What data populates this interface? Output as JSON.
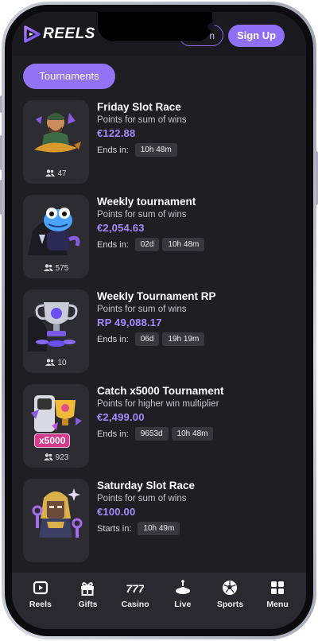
{
  "brand": {
    "name": "REELS"
  },
  "header": {
    "login_label": "n",
    "signup_label": "Sign Up"
  },
  "tab": {
    "label": "Tournaments"
  },
  "tournaments": [
    {
      "title": "Friday Slot Race",
      "desc": "Points for sum of wins",
      "prize": "€122.88",
      "timer_label": "Ends in:",
      "chips": [
        "10h 48m"
      ],
      "players": "47",
      "art": "fisher"
    },
    {
      "title": "Weekly tournament",
      "desc": "Points for sum of wins",
      "prize": "€2,054.63",
      "timer_label": "Ends in:",
      "chips": [
        "02d",
        "10h 48m"
      ],
      "players": "575",
      "art": "frog"
    },
    {
      "title": "Weekly Tournament RP",
      "desc": "Points for sum of wins",
      "prize": "RP  49,088.17",
      "timer_label": "Ends in:",
      "chips": [
        "06d",
        "19h 19m"
      ],
      "players": "10",
      "art": "trophy"
    },
    {
      "title": "Catch x5000 Tournament",
      "desc": "Points for higher win multiplier",
      "prize": "€2,499.00",
      "timer_label": "Ends in:",
      "chips": [
        "9653d",
        "10h 48m"
      ],
      "players": "923",
      "art": "x5000",
      "badge": "x5000"
    },
    {
      "title": "Saturday Slot Race",
      "desc": "Points for sum of wins",
      "prize": "€100.00",
      "timer_label": "Starts in:",
      "chips": [
        "10h 49m"
      ],
      "players": "",
      "art": "pharaoh"
    }
  ],
  "nav": [
    {
      "label": "Reels",
      "icon": "play-square-icon"
    },
    {
      "label": "Gifts",
      "icon": "gift-icon"
    },
    {
      "label": "Casino",
      "icon": "sevens-icon"
    },
    {
      "label": "Live",
      "icon": "roulette-icon"
    },
    {
      "label": "Sports",
      "icon": "soccer-ball-icon"
    },
    {
      "label": "Menu",
      "icon": "grid-icon"
    }
  ],
  "colors": {
    "accent": "#8e6ff5",
    "prize": "#a48bff",
    "bg": "#1f1e23",
    "card": "#2d2c33"
  }
}
